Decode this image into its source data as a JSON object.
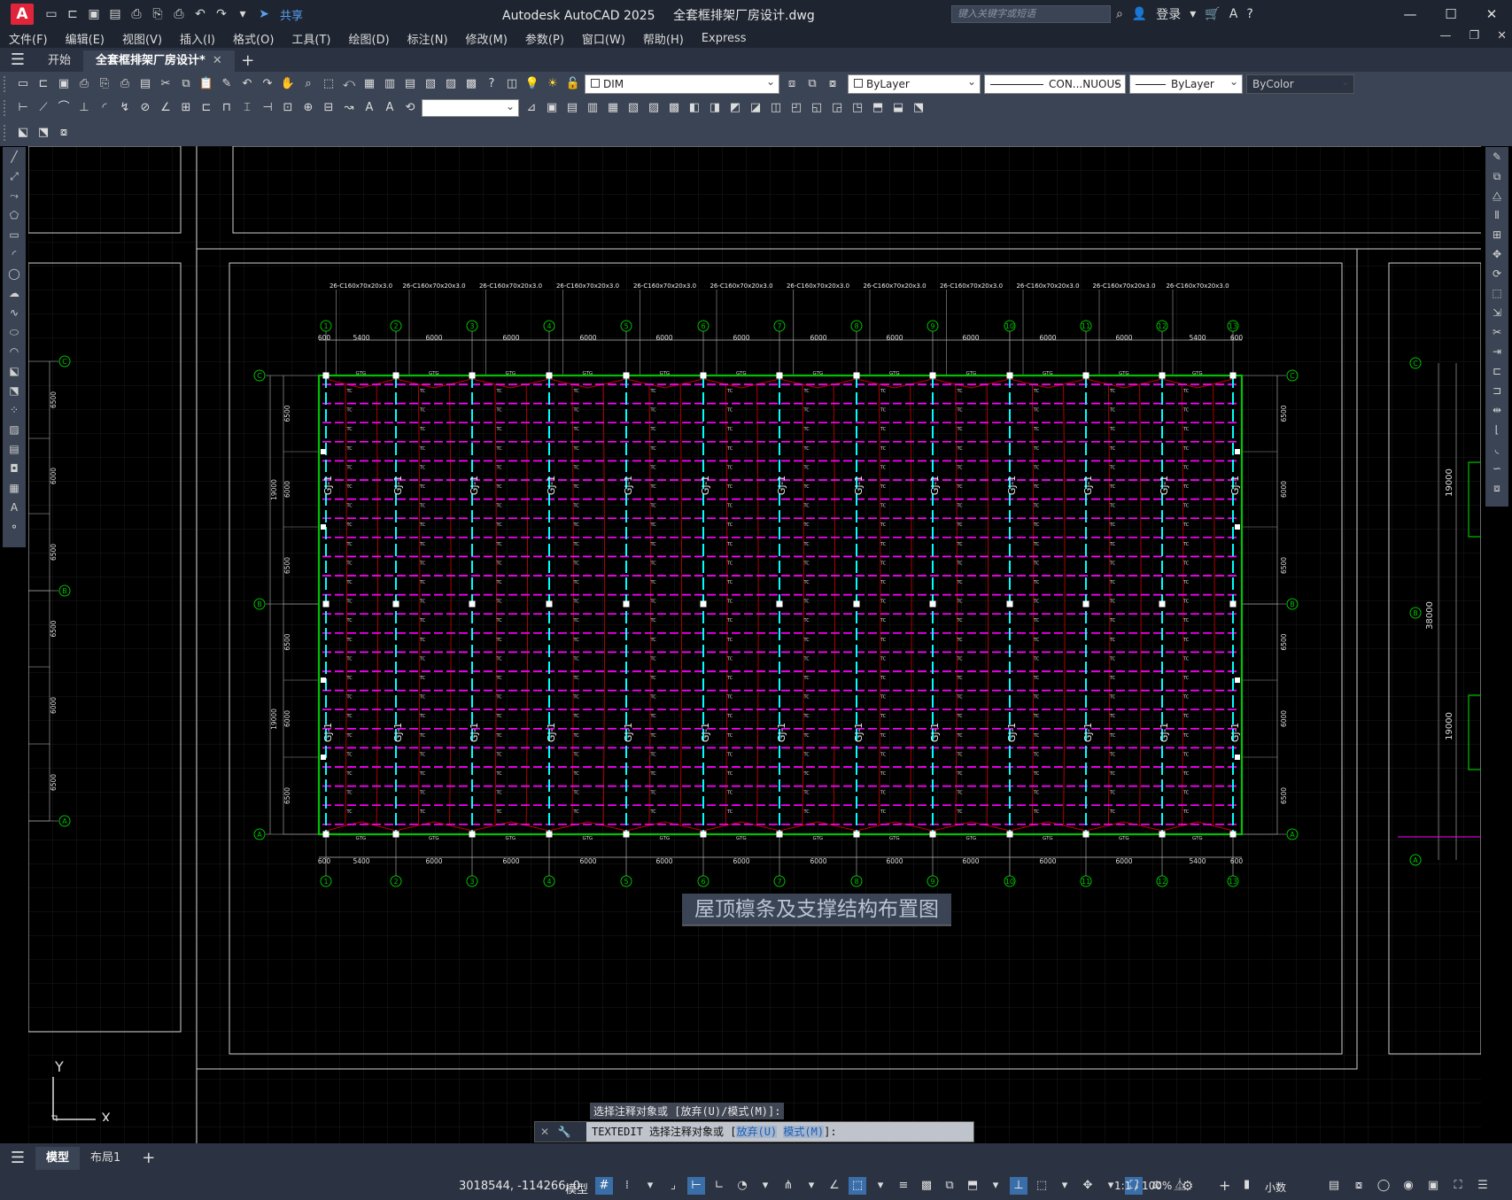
{
  "titlebar": {
    "app_title": "Autodesk AutoCAD 2025",
    "file_name": "全套框排架厂房设计.dwg",
    "share_label": "共享",
    "search_placeholder": "键入关键字或短语",
    "login_label": "登录",
    "logo_letter": "A"
  },
  "menu": [
    "文件(F)",
    "编辑(E)",
    "视图(V)",
    "插入(I)",
    "格式(O)",
    "工具(T)",
    "绘图(D)",
    "标注(N)",
    "修改(M)",
    "参数(P)",
    "窗口(W)",
    "帮助(H)",
    "Express"
  ],
  "tabs": {
    "start": "开始",
    "active": "全套框排架厂房设计*",
    "close": "✕",
    "add": "+"
  },
  "properties": {
    "layer": "DIM",
    "color": "ByLayer",
    "linetype": "CON...NUOUS",
    "lineweight": "ByLayer",
    "plotstyle": "ByColor"
  },
  "drawing": {
    "title": "屋顶檩条及支撑结构布置图",
    "grid_numbers": [
      "1",
      "2",
      "3",
      "4",
      "5",
      "6",
      "7",
      "8",
      "9",
      "10",
      "11",
      "12",
      "13"
    ],
    "row_letters": [
      "C",
      "B",
      "A"
    ],
    "top_dims": [
      "600",
      "5400",
      "6000",
      "6000",
      "6000",
      "6000",
      "6000",
      "6000",
      "6000",
      "6000",
      "6000",
      "6000",
      "5400",
      "600"
    ],
    "purlin_label": "26-C160x70x20x3.0",
    "frame_label": "GJ-1",
    "bay_dims": [
      "6500",
      "6000",
      "6500",
      "6500",
      "6000",
      "6500"
    ],
    "span_dims": [
      "19000",
      "19000"
    ],
    "total_dim": "38000",
    "tag_tc": "TC",
    "tag_gtg": "GTG"
  },
  "command": {
    "history": "选择注释对象或 [放弃(U)/模式(M)]:",
    "prompt_cmd": "TEXTEDIT",
    "prompt_text": "选择注释对象或 [",
    "kw1": "放弃(U)",
    "kw2": "模式(M)",
    "prompt_end": "]:"
  },
  "layout": {
    "model_tab": "模型",
    "layout1_tab": "布局1",
    "add": "+"
  },
  "status": {
    "coords": "3018544, -114266, 0",
    "mode": "模型",
    "scale": "1:1 / 100%",
    "units": "小数"
  },
  "ucs": {
    "x_label": "X",
    "y_label": "Y"
  },
  "colors": {
    "purlin": "#ff00ff",
    "frame": "#00ffff",
    "outline": "#00c000",
    "brace": "#c00000",
    "grid_bubble": "#00c000",
    "ui_bg": "#3b4454",
    "bar_bg": "#2b3241"
  }
}
